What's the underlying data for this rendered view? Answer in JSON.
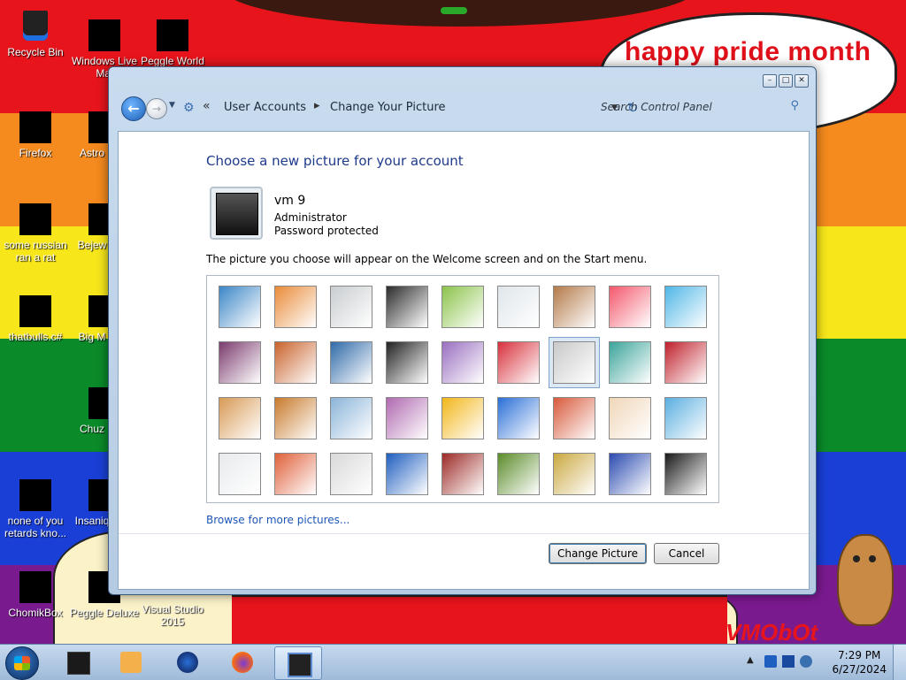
{
  "wallpaper": {
    "speech_text": "happy pride month",
    "watermark": "VMObOt"
  },
  "desktop_icons": [
    {
      "label": "Recycle Bin"
    },
    {
      "label": "Windows Live Mai"
    },
    {
      "label": "Peggle World"
    },
    {
      "label": "Firefox"
    },
    {
      "label": "Astro Delu"
    },
    {
      "label": "some russian ran a rat"
    },
    {
      "label": "Bejew Delu"
    },
    {
      "label": "thatbulls.c#"
    },
    {
      "label": "Big M Delu"
    },
    {
      "label": "Chuz Delu"
    },
    {
      "label": "none of you retards kno..."
    },
    {
      "label": "Insaniq Delu"
    },
    {
      "label": "ChomikBox"
    },
    {
      "label": "Peggle Deluxe"
    },
    {
      "label": "Visual Studio 2015"
    }
  ],
  "window": {
    "controls": {
      "minimize": "–",
      "restore": "□",
      "close": "✕"
    },
    "breadcrumb": {
      "separator": "«",
      "root": "User Accounts",
      "arrow": "▸",
      "current": "Change Your Picture"
    },
    "search_placeholder": "Search Control Panel",
    "heading": "Choose a new picture for your account",
    "user": {
      "name": "vm 9",
      "role": "Administrator",
      "protection": "Password protected"
    },
    "description": "The picture you choose will appear on the Welcome screen and on the Start menu.",
    "pictures": [
      {
        "name": "roller-coaster",
        "color": "#3b86c6"
      },
      {
        "name": "starfish",
        "color": "#e98b38"
      },
      {
        "name": "robot-toy",
        "color": "#c9cdd0"
      },
      {
        "name": "record-player",
        "color": "#2b2b2b"
      },
      {
        "name": "lucky-cat",
        "color": "#8bc34a"
      },
      {
        "name": "gyroscope",
        "color": "#dfe6ea"
      },
      {
        "name": "kitten",
        "color": "#b47a4a"
      },
      {
        "name": "flower",
        "color": "#f3586c"
      },
      {
        "name": "ferris-wheel",
        "color": "#4fb6e6"
      },
      {
        "name": "ball",
        "color": "#7b3b6e"
      },
      {
        "name": "fabric",
        "color": "#c9632c"
      },
      {
        "name": "leaf",
        "color": "#2f6aa8"
      },
      {
        "name": "dog",
        "color": "#222222"
      },
      {
        "name": "crayons",
        "color": "#9a6fc0"
      },
      {
        "name": "red-star",
        "color": "#d8303c"
      },
      {
        "name": "jacks",
        "color": "#c9c9c9"
      },
      {
        "name": "stairs",
        "color": "#3ba49a"
      },
      {
        "name": "origami-crane",
        "color": "#c0202b"
      },
      {
        "name": "guitar",
        "color": "#d89a55"
      },
      {
        "name": "puppy",
        "color": "#c87a2a"
      },
      {
        "name": "tin-robot",
        "color": "#8bb4d8"
      },
      {
        "name": "scarves",
        "color": "#b06ab0"
      },
      {
        "name": "sunflower",
        "color": "#f2b619"
      },
      {
        "name": "fish",
        "color": "#2a6fd8"
      },
      {
        "name": "balloon",
        "color": "#d85a3c"
      },
      {
        "name": "doll",
        "color": "#f0d6b8"
      },
      {
        "name": "sailboat",
        "color": "#5aaee0"
      },
      {
        "name": "soccer-ball",
        "color": "#e8eaec"
      },
      {
        "name": "stripes",
        "color": "#e0603a"
      },
      {
        "name": "marbles",
        "color": "#d9d9d9"
      },
      {
        "name": "window",
        "color": "#1f5fbf"
      },
      {
        "name": "pattern",
        "color": "#9c2a26"
      },
      {
        "name": "butterfly",
        "color": "#5b8c2a"
      },
      {
        "name": "shell",
        "color": "#caa840"
      },
      {
        "name": "lighthouse",
        "color": "#2a4ab0"
      },
      {
        "name": "current-picture",
        "color": "#1a1a1a"
      }
    ],
    "selected_picture_index": 15,
    "browse_link": "Browse for more pictures...",
    "buttons": {
      "change": "Change Picture",
      "cancel": "Cancel"
    }
  },
  "taskbar": {
    "clock_time": "7:29 PM",
    "clock_date": "6/27/2024",
    "tray_expand": "▲"
  }
}
